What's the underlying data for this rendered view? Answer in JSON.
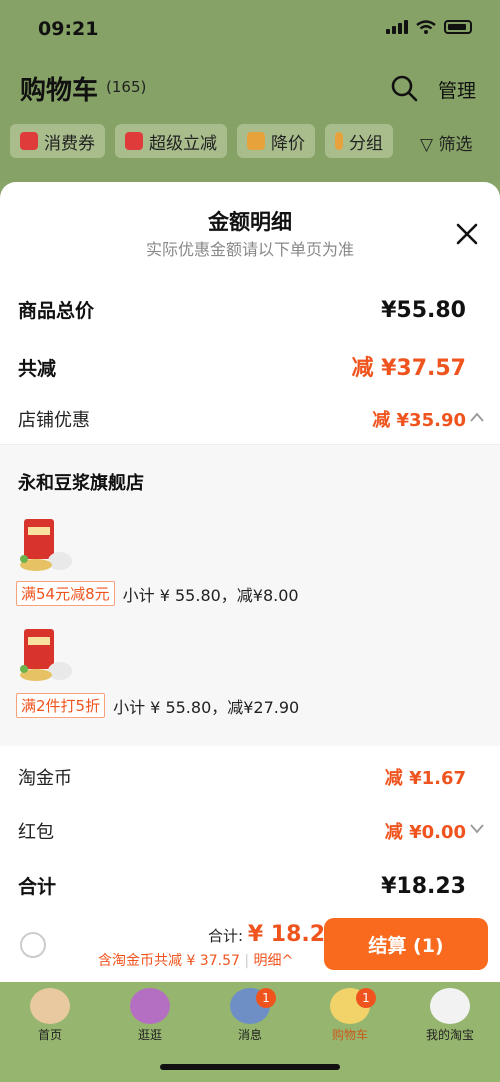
{
  "status": {
    "time": "09:21"
  },
  "header": {
    "title": "购物车",
    "count": "(165)",
    "manage": "管理"
  },
  "chips": [
    {
      "label": "消费券",
      "icon": "coupon-icon",
      "color": "#e03b3b"
    },
    {
      "label": "超级立减",
      "icon": "arrow-down-icon",
      "color": "#e03b3b"
    },
    {
      "label": "降价",
      "icon": "price-down-icon",
      "color": "#e8a23c"
    },
    {
      "label": "分组",
      "icon": "folder-icon",
      "color": "#e8a23c"
    }
  ],
  "filter": "筛选",
  "sheet": {
    "title": "金额明细",
    "subtitle": "实际优惠金额请以下单页为准",
    "goods_total_label": "商品总价",
    "goods_total": "¥55.80",
    "discount_label": "共减",
    "discount": "减 ¥37.57",
    "store_discount_label": "店铺优惠",
    "store_discount": "减 ¥35.90",
    "store_name": "永和豆浆旗舰店",
    "promos": [
      {
        "tag": "满54元减8元",
        "text": "小计 ¥ 55.80，减¥8.00"
      },
      {
        "tag": "满2件打5折",
        "text": "小计 ¥ 55.80，减¥27.90"
      }
    ],
    "coins_label": "淘金币",
    "coins": "减 ¥1.67",
    "redpacket_label": "红包",
    "redpacket": "减 ¥0.00",
    "sum_label": "合计",
    "sum": "¥18.23"
  },
  "checkout": {
    "total_label": "合计:",
    "total_value": "¥ 18.23",
    "coin_text": "含淘金币共减 ¥ 37.57",
    "detail_link": "明细",
    "button": "结算 (1)"
  },
  "tabs": [
    {
      "label": "首页"
    },
    {
      "label": "逛逛"
    },
    {
      "label": "消息",
      "badge": "1"
    },
    {
      "label": "购物车",
      "badge": "1"
    },
    {
      "label": "我的淘宝"
    }
  ],
  "colors": {
    "accent": "#f96a1e",
    "discount": "#f0541e"
  }
}
